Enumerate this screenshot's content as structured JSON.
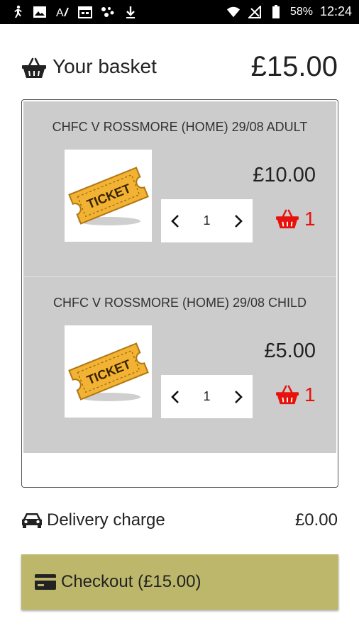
{
  "status_bar": {
    "battery_percent": "58%",
    "time": "12:24",
    "left_icons": [
      "runner-icon",
      "image-icon",
      "text-style-icon",
      "calendar-icon",
      "dots-icon",
      "download-icon"
    ],
    "right_icons": [
      "wifi-icon",
      "signal-icon",
      "battery-icon"
    ]
  },
  "header": {
    "title": "Your basket",
    "total": "£15.00",
    "icon": "basket-icon"
  },
  "items": [
    {
      "name": "CHFC V ROSSMORE (HOME) 29/08 ADULT",
      "image_label": "TICKET",
      "price": "£10.00",
      "quantity": "1",
      "remove_count": "1"
    },
    {
      "name": "CHFC V ROSSMORE (HOME) 29/08 CHILD",
      "image_label": "TICKET",
      "price": "£5.00",
      "quantity": "1",
      "remove_count": "1"
    }
  ],
  "delivery": {
    "label": "Delivery charge",
    "value": "£0.00",
    "icon": "car-icon"
  },
  "checkout": {
    "label": "Checkout (£15.00)",
    "icon": "credit-card-icon"
  },
  "colors": {
    "status_bar": "#000000",
    "item_background": "#cccccc",
    "remove_red": "#e8120c",
    "checkout_button": "#bdb76b"
  }
}
